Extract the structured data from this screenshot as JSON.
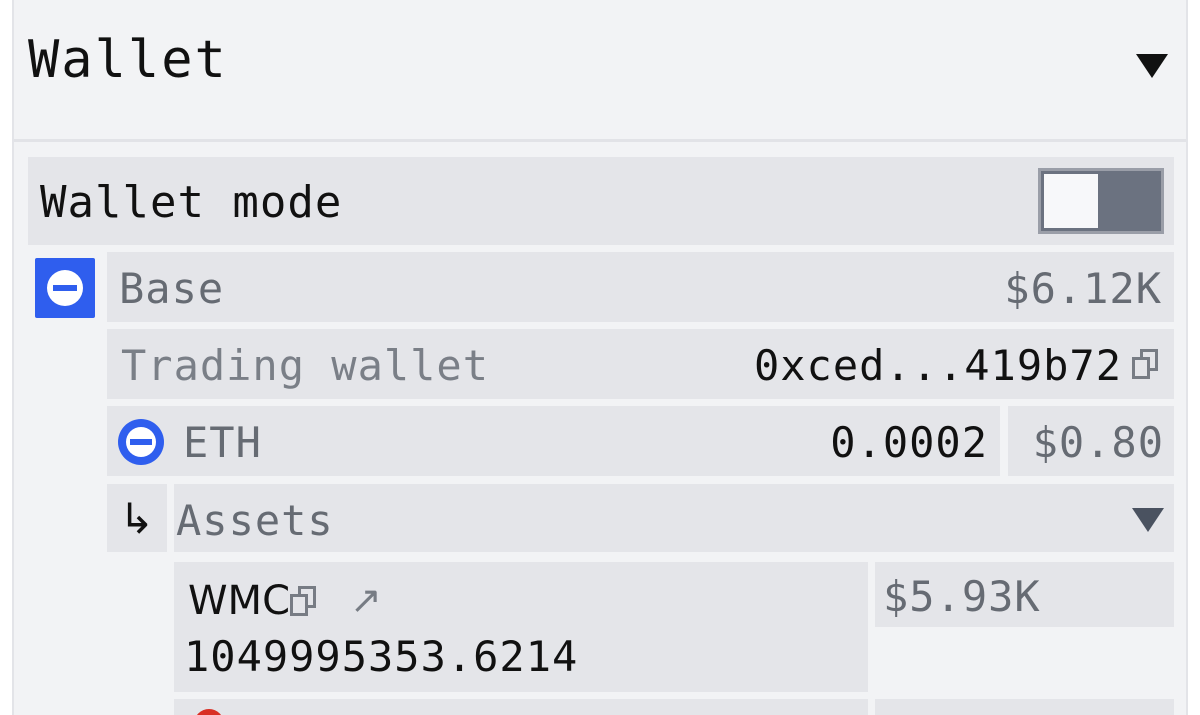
{
  "header": {
    "title": "Wallet",
    "expand_icon": "caret-down-icon"
  },
  "wallet_mode": {
    "label": "Wallet mode",
    "enabled": false
  },
  "chain": {
    "name": "Base",
    "total_value": "$6.12K",
    "icon": "base-chain-icon",
    "icon_color": "#2f5eee"
  },
  "trading_wallet": {
    "label": "Trading wallet",
    "address": "0xced...419b72",
    "copy_icon": "copy-icon"
  },
  "native_balance": {
    "symbol": "ETH",
    "amount": "0.0002",
    "usd": "$0.80"
  },
  "assets": {
    "label": "Assets",
    "arrow": "↳",
    "items": [
      {
        "symbol": "WMC",
        "amount": "1049995353.6214",
        "usd": "$5.93K"
      }
    ]
  }
}
